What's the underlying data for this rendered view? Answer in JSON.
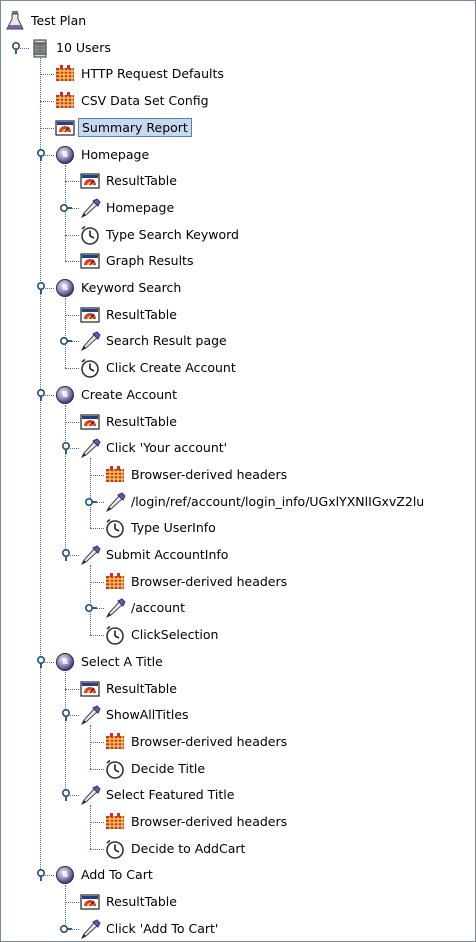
{
  "colors": {
    "selection_bg": "#c6d9f0",
    "selection_border": "#5a7fb5",
    "guide_line": "#4f6f8f"
  },
  "tree": [
    {
      "label": "Test Plan",
      "level": 0,
      "icon": "test-plan-icon",
      "toggle": "none",
      "last": true
    },
    {
      "label": "10 Users",
      "level": 1,
      "icon": "thread-group-icon",
      "toggle": "expanded",
      "last": true
    },
    {
      "label": "HTTP Request Defaults",
      "level": 2,
      "icon": "config-element-icon",
      "toggle": "none",
      "last": false
    },
    {
      "label": "CSV Data Set Config",
      "level": 2,
      "icon": "config-element-icon",
      "toggle": "none",
      "last": false
    },
    {
      "label": "Summary Report",
      "level": 2,
      "icon": "listener-icon",
      "toggle": "none",
      "last": false,
      "selected": true
    },
    {
      "label": "Homepage",
      "level": 2,
      "icon": "controller-icon",
      "toggle": "expanded",
      "last": false
    },
    {
      "label": "ResultTable",
      "level": 3,
      "icon": "listener-icon",
      "toggle": "none",
      "last": false
    },
    {
      "label": "Homepage",
      "level": 3,
      "icon": "sampler-icon",
      "toggle": "collapsed",
      "last": false
    },
    {
      "label": "Type Search Keyword",
      "level": 3,
      "icon": "timer-icon",
      "toggle": "none",
      "last": false
    },
    {
      "label": "Graph Results",
      "level": 3,
      "icon": "listener-icon",
      "toggle": "none",
      "last": true
    },
    {
      "label": "Keyword Search",
      "level": 2,
      "icon": "controller-icon",
      "toggle": "expanded",
      "last": false
    },
    {
      "label": "ResultTable",
      "level": 3,
      "icon": "listener-icon",
      "toggle": "none",
      "last": false
    },
    {
      "label": "Search Result page",
      "level": 3,
      "icon": "sampler-icon",
      "toggle": "collapsed",
      "last": false
    },
    {
      "label": "Click Create Account",
      "level": 3,
      "icon": "timer-icon",
      "toggle": "none",
      "last": true
    },
    {
      "label": "Create Account",
      "level": 2,
      "icon": "controller-icon",
      "toggle": "expanded",
      "last": false
    },
    {
      "label": "ResultTable",
      "level": 3,
      "icon": "listener-icon",
      "toggle": "none",
      "last": false
    },
    {
      "label": "Click 'Your account'",
      "level": 3,
      "icon": "sampler-icon",
      "toggle": "expanded",
      "last": false
    },
    {
      "label": "Browser-derived headers",
      "level": 4,
      "icon": "config-element-icon",
      "toggle": "none",
      "last": false
    },
    {
      "label": "/login/ref/account/login_info/UGxlYXNlIGxvZ2lu",
      "level": 4,
      "icon": "sampler-icon",
      "toggle": "collapsed",
      "last": false
    },
    {
      "label": "Type UserInfo",
      "level": 4,
      "icon": "timer-icon",
      "toggle": "none",
      "last": true
    },
    {
      "label": "Submit AccountInfo",
      "level": 3,
      "icon": "sampler-icon",
      "toggle": "expanded",
      "last": true
    },
    {
      "label": "Browser-derived headers",
      "level": 4,
      "icon": "config-element-icon",
      "toggle": "none",
      "last": false
    },
    {
      "label": "/account",
      "level": 4,
      "icon": "sampler-icon",
      "toggle": "collapsed",
      "last": false
    },
    {
      "label": "ClickSelection",
      "level": 4,
      "icon": "timer-icon",
      "toggle": "none",
      "last": true
    },
    {
      "label": "Select A Title",
      "level": 2,
      "icon": "controller-icon",
      "toggle": "expanded",
      "last": false
    },
    {
      "label": "ResultTable",
      "level": 3,
      "icon": "listener-icon",
      "toggle": "none",
      "last": false
    },
    {
      "label": "ShowAllTitles",
      "level": 3,
      "icon": "sampler-icon",
      "toggle": "expanded",
      "last": false
    },
    {
      "label": "Browser-derived headers",
      "level": 4,
      "icon": "config-element-icon",
      "toggle": "none",
      "last": false
    },
    {
      "label": "Decide Title",
      "level": 4,
      "icon": "timer-icon",
      "toggle": "none",
      "last": true
    },
    {
      "label": "Select Featured Title",
      "level": 3,
      "icon": "sampler-icon",
      "toggle": "expanded",
      "last": true
    },
    {
      "label": "Browser-derived headers",
      "level": 4,
      "icon": "config-element-icon",
      "toggle": "none",
      "last": false
    },
    {
      "label": "Decide to AddCart",
      "level": 4,
      "icon": "timer-icon",
      "toggle": "none",
      "last": true
    },
    {
      "label": "Add To Cart",
      "level": 2,
      "icon": "controller-icon",
      "toggle": "expanded",
      "last": false
    },
    {
      "label": "ResultTable",
      "level": 3,
      "icon": "listener-icon",
      "toggle": "none",
      "last": false
    },
    {
      "label": "Click 'Add To Cart'",
      "level": 3,
      "icon": "sampler-icon",
      "toggle": "collapsed",
      "last": false
    }
  ]
}
